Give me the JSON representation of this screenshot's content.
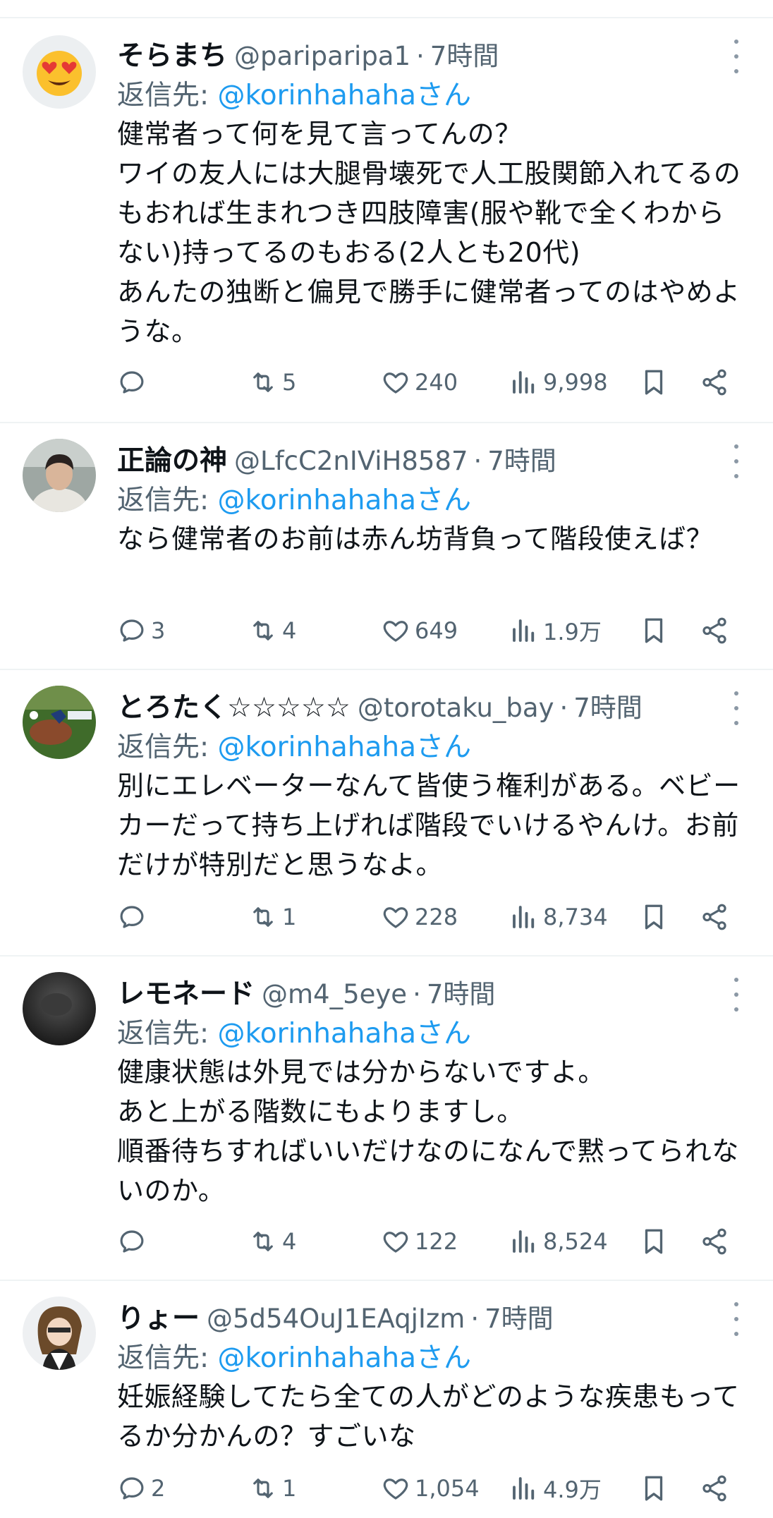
{
  "reply_prefix": "返信先: ",
  "tweets": [
    {
      "name": "そらまち",
      "handle": "@pariparipa1",
      "time": "7時間",
      "reply_to": "@korinhahahaさん",
      "text": "健常者って何を見て言ってんの？\nワイの友人には大腿骨壊死で人工股関節入れてるのもおれば生まれつき四肢障害(服や靴で全くわからない)持ってるのもおる(2人とも20代)\nあんたの独断と偏見で勝手に健常者ってのはやめような。",
      "replies": "",
      "retweets": "5",
      "likes": "240",
      "views": "9,998",
      "avatar": "heart-eyes-emoji"
    },
    {
      "name": "正論の神",
      "handle": "@LfcC2nIViH8587",
      "time": "7時間",
      "reply_to": "@korinhahahaさん",
      "text": "なら健常者のお前は赤ん坊背負って階段使えば？",
      "replies": "3",
      "retweets": "4",
      "likes": "649",
      "views": "1.9万",
      "avatar": "person-photo"
    },
    {
      "name": "とろたく☆☆☆☆☆",
      "handle": "@torotaku_bay",
      "time": "7時間",
      "reply_to": "@korinhahahaさん",
      "text": "別にエレベーターなんて皆使う権利がある。ベビーカーだって持ち上げれば階段でいけるやんけ。お前だけが特別だと思うなよ。",
      "replies": "",
      "retweets": "1",
      "likes": "228",
      "views": "8,734",
      "avatar": "baseball-field-photo"
    },
    {
      "name": "レモネード",
      "handle": "@m4_5eye",
      "time": "7時間",
      "reply_to": "@korinhahahaさん",
      "text": "健康状態は外見では分からないですよ。\nあと上がる階数にもよりますし。\n順番待ちすればいいだけなのになんで黙ってられないのか。",
      "replies": "",
      "retweets": "4",
      "likes": "122",
      "views": "8,524",
      "avatar": "dark-photo"
    },
    {
      "name": "りょー",
      "handle": "@5d54OuJ1EAqjIzm",
      "time": "7時間",
      "reply_to": "@korinhahahaさん",
      "text": "妊娠経験してたら全ての人がどのような疾患もってるか分かんの？すごいな",
      "replies": "2",
      "retweets": "1",
      "likes": "1,054",
      "views": "4.9万",
      "avatar": "anime-character-illustration"
    }
  ]
}
